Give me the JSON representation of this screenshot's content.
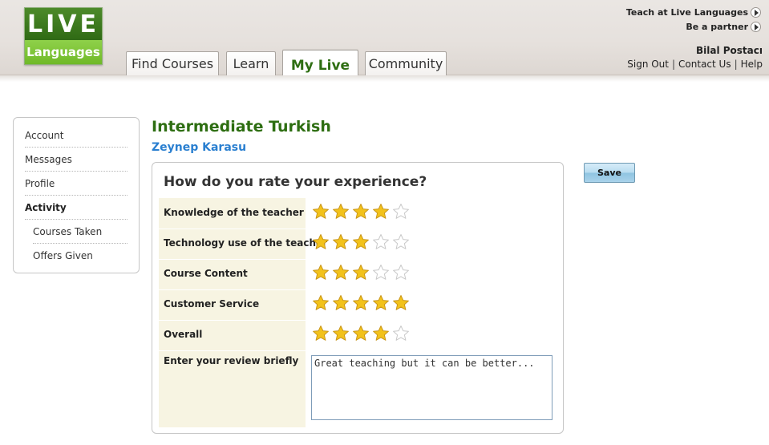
{
  "logo": {
    "top": "LIVE",
    "bottom": "Languages"
  },
  "nav": {
    "tabs": [
      {
        "label": "Find Courses",
        "active": false
      },
      {
        "label": "Learn",
        "active": false
      },
      {
        "label": "My Live",
        "active": true
      },
      {
        "label": "Community",
        "active": false
      }
    ]
  },
  "header_links": {
    "teach": "Teach at Live Languages",
    "partner": "Be a partner",
    "user_name": "Bilal Postacı",
    "sign_out": "Sign Out",
    "contact": "Contact Us",
    "help": "Help"
  },
  "sidebar": {
    "items": [
      {
        "label": "Account"
      },
      {
        "label": "Messages"
      },
      {
        "label": "Profile"
      },
      {
        "label": "Activity"
      },
      {
        "label": "Courses Taken"
      },
      {
        "label": "Offers Given"
      }
    ]
  },
  "course": {
    "title": "Intermediate Turkish",
    "teacher": "Zeynep Karasu"
  },
  "rating": {
    "question": "How do you rate your experience?",
    "max_stars": 5,
    "rows": [
      {
        "label": "Knowledge of the teacher",
        "stars": 4
      },
      {
        "label": "Technology use of the teacher",
        "stars": 3
      },
      {
        "label": "Course Content",
        "stars": 3
      },
      {
        "label": "Customer Service",
        "stars": 5
      },
      {
        "label": "Overall",
        "stars": 4
      }
    ],
    "review_label": "Enter your review briefly",
    "review_text": "Great teaching but it can be better..."
  },
  "actions": {
    "save_label": "Save"
  },
  "colors": {
    "brand_green": "#2e6e12",
    "link_blue": "#2a7fd0",
    "star_filled": "#f2c21b",
    "label_bg": "#f7f4e2"
  }
}
